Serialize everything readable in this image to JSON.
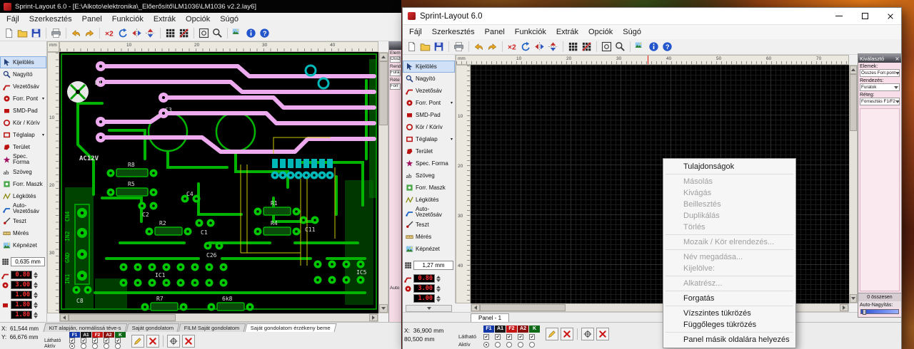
{
  "app": {
    "menu": [
      "Fájl",
      "Szerkesztés",
      "Panel",
      "Funkciók",
      "Extrák",
      "Opciók",
      "Súgó"
    ],
    "tools": [
      "Kijelölés",
      "Nagyító",
      "Vezetősáv",
      "Forr. Pont",
      "SMD-Pad",
      "Kör / Körív",
      "Téglalap",
      "Terület",
      "Spec. Forma",
      "Szöveg",
      "Forr. Maszk",
      "Légkötés",
      "Auto-Vezetősáv",
      "Teszt",
      "Mérés",
      "Képnézet"
    ],
    "ruler_unit": "mm",
    "layers": [
      "F1",
      "A1",
      "F2",
      "A2",
      "K"
    ],
    "visible_label": "Látható",
    "active_label": "Aktív",
    "colors": {
      "selection_blue": "#cfe0f7",
      "pcb_green": "#00b400",
      "pcb_pink": "#eeaaee",
      "pcb_teal": "#00b8b8",
      "pcb_yellow": "#c8c800",
      "spinner_red": "#ff3030",
      "selector_pink": "#f8dee8"
    }
  },
  "bg": {
    "title": "Sprint-Layout 6.0 - [E:\\Alkoto\\elektronika\\_Előerősítő\\LM1036\\LM1036 v2.2.lay6]",
    "grid_value": "0,635 mm",
    "spinners": [
      "0.80",
      "3.00",
      "1.00",
      "1.80",
      "1.80"
    ],
    "hruler": [
      "10",
      "20",
      "30",
      "40"
    ],
    "vruler": [
      "10",
      "20",
      "30"
    ],
    "tabs": [
      "KIT alapján, normálissá téve-s",
      "Saját gondolatom",
      "FILM Saját gondolatom",
      "Saját gondolatom érzékeny beme"
    ],
    "status_x": "X:  61,544 mm",
    "status_y": "Y:  66,676 mm",
    "sliver": [
      "Elem",
      "Össz",
      "Rend",
      "Fura",
      "Réte",
      "Forr",
      "Auto"
    ],
    "pcb_labels": [
      "D1",
      "C3",
      "AC12V",
      "R8",
      "R5",
      "C2",
      "C4",
      "R1",
      "R2",
      "C1",
      "C26",
      "R4",
      "C11",
      "IC1",
      "IC5",
      "C8",
      "R7",
      "6k8",
      "CN4",
      "IN2",
      "GND",
      "IN1"
    ]
  },
  "fg": {
    "title": "Sprint-Layout 6.0",
    "grid_value": "1,27 mm",
    "spinners": [
      "0.80",
      "3.00",
      "1.00"
    ],
    "hruler": [
      "10",
      "20",
      "30",
      "40",
      "50",
      "60",
      "70"
    ],
    "vruler": [
      "10",
      "20",
      "30",
      "40"
    ],
    "panel_tab": "Panel - 1",
    "status_x": "X:  36,900 mm",
    "status_y": "80,500 mm",
    "selector": {
      "title": "Kiválasztó",
      "elements_label": "Elemek:",
      "elements_value": "Összes Forr.pont",
      "sort_label": "Rendezés:",
      "sort_value": "Furatok",
      "layer_label": "Réteg:",
      "layer_value": "Forrasztás F1/F2",
      "count": "0 összesen",
      "autozoom_label": "Auto-Nagyítás:"
    },
    "context": [
      {
        "label": "Tulajdonságok",
        "disabled": false
      },
      {
        "label": "Másolás",
        "disabled": true
      },
      {
        "label": "Kivágás",
        "disabled": true
      },
      {
        "label": "Beillesztés",
        "disabled": true
      },
      {
        "label": "Duplikálás",
        "disabled": true
      },
      {
        "label": "Törlés",
        "disabled": true
      },
      {
        "label": "Mozaik / Kör elrendezés...",
        "disabled": true
      },
      {
        "label": "Név megadása...",
        "disabled": true
      },
      {
        "label": "Kijelölve:",
        "disabled": true
      },
      {
        "label": "Alkatrész...",
        "disabled": true
      },
      {
        "label": "Forgatás",
        "disabled": false
      },
      {
        "label": "Vízszintes tükrözés",
        "disabled": false
      },
      {
        "label": "Függőleges tükrözés",
        "disabled": false
      },
      {
        "label": "Panel másik oldalára helyezés",
        "disabled": false
      }
    ]
  }
}
